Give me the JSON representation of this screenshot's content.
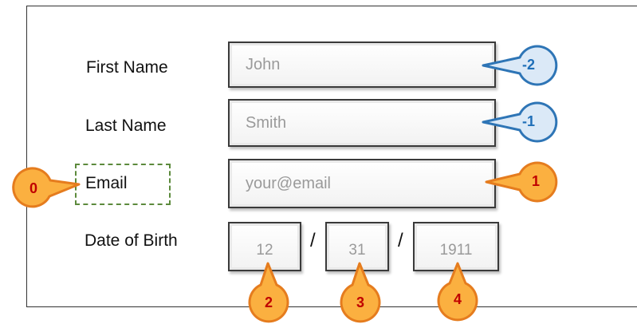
{
  "form": {
    "first_name_label": "First Name",
    "last_name_label": "Last Name",
    "email_label": "Email",
    "dob_label": "Date of Birth",
    "first_name_value": "John",
    "last_name_value": "Smith",
    "email_value": "your@email",
    "dob_month": "12",
    "dob_day": "31",
    "dob_year": "1911",
    "separator": "/"
  },
  "callouts": {
    "first_name": "-2",
    "last_name": "-1",
    "email_label": "0",
    "email_field": "1",
    "dob_month": "2",
    "dob_day": "3",
    "dob_year": "4"
  },
  "colors": {
    "orange_fill": "#fbb040",
    "orange_stroke": "#e57c1e",
    "orange_text": "#c00000",
    "blue_fill": "#dbe9f7",
    "blue_stroke": "#2e75b6",
    "blue_text": "#1f6fb8",
    "dashed_box": "#5c8a3c"
  }
}
